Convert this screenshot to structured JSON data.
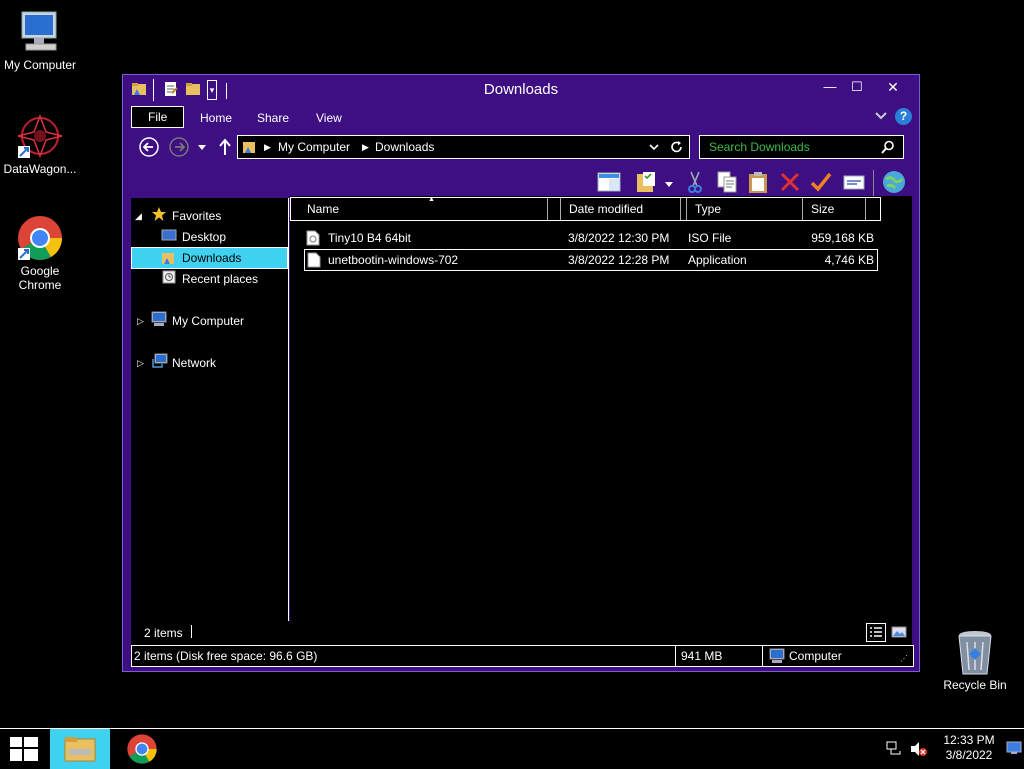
{
  "desktop": {
    "icons": [
      {
        "label": "My Computer",
        "icon": "monitor-icon"
      },
      {
        "label": "DataWagon...",
        "icon": "datawagon-icon"
      },
      {
        "label": "Google Chrome",
        "icon": "chrome-icon"
      },
      {
        "label": "Recycle Bin",
        "icon": "recycle-bin-icon"
      }
    ]
  },
  "window": {
    "title": "Downloads",
    "controls": {
      "minimize": "—",
      "maximize": "☐",
      "close": "✕"
    },
    "ribbon_tabs": [
      "File",
      "Home",
      "Share",
      "View"
    ],
    "address": {
      "segments": [
        "My Computer",
        "Downloads"
      ]
    },
    "search": {
      "placeholder": "Search Downloads"
    },
    "columns": [
      "Name",
      "Date modified",
      "Type",
      "Size"
    ],
    "files": [
      {
        "name": "Tiny10 B4 64bit",
        "date": "3/8/2022 12:30 PM",
        "type": "ISO File",
        "size": "959,168 KB"
      },
      {
        "name": "unetbootin-windows-702",
        "date": "3/8/2022 12:28 PM",
        "type": "Application",
        "size": "4,746 KB"
      }
    ],
    "nav": {
      "favorites": "Favorites",
      "desktop": "Desktop",
      "downloads": "Downloads",
      "recent": "Recent places",
      "computer": "My Computer",
      "network": "Network"
    },
    "status": {
      "items": "2 items",
      "disk": "2 items (Disk free space: 96.6 GB)",
      "size": "941 MB",
      "location": "Computer"
    }
  },
  "taskbar": {
    "time": "12:33 PM",
    "date": "3/8/2022"
  },
  "colors": {
    "window_frame": "#3d0f82",
    "selection": "#40d0f0",
    "search_text": "#3fb84c"
  }
}
